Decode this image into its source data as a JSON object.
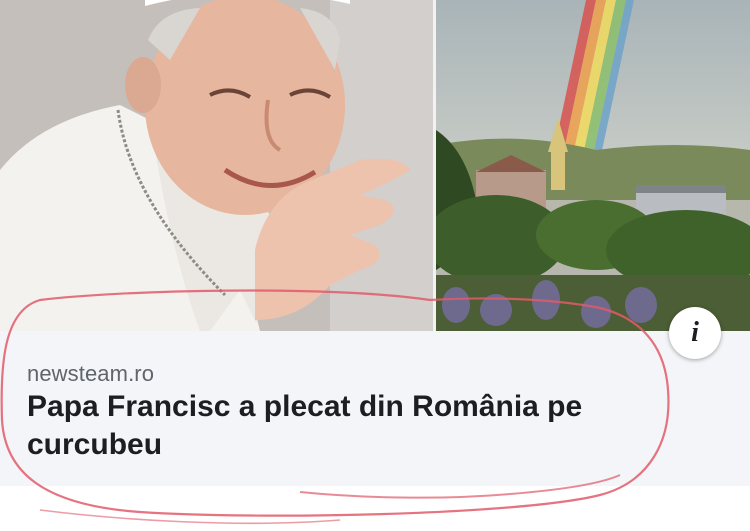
{
  "link_preview": {
    "source": "newsteam.ro",
    "headline": "Papa Francisc a plecat din România pe curcubeu",
    "info_icon": "i"
  },
  "images": {
    "left_photo": "pope-waving-photo",
    "right_photo": "rainbow-over-town-photo"
  },
  "colors": {
    "card_background": "#f4f5f8",
    "source_text": "#60646b",
    "headline_text": "#1c1e21",
    "annotation_stroke": "#e05a6a"
  }
}
